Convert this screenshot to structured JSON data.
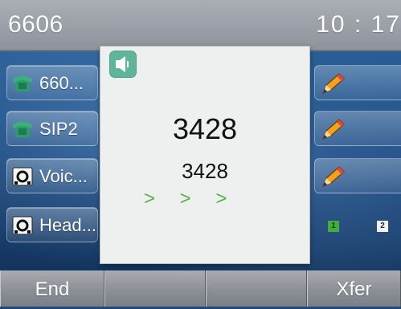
{
  "status_bar": {
    "account": "6606",
    "clock": "10 : 17"
  },
  "line_keys": [
    {
      "label": "660...",
      "icon": "phone-icon"
    },
    {
      "label": "SIP2",
      "icon": "phone-icon"
    },
    {
      "label": "Voic...",
      "icon": "voicemail-icon"
    },
    {
      "label": "Head...",
      "icon": "headset-icon"
    }
  ],
  "right_keys": [
    {
      "icon": "pencil-icon"
    },
    {
      "icon": "pencil-icon"
    },
    {
      "icon": "pencil-icon"
    }
  ],
  "call": {
    "number": "3428",
    "name": "3428",
    "status_icon": "speaker-icon",
    "progress_arrows": "> > >"
  },
  "pages": {
    "page1": "1",
    "page2": "2",
    "active": "1"
  },
  "softkeys": {
    "key1": "End",
    "key2": "",
    "key3": "",
    "key4": "Xfer"
  },
  "colors": {
    "accent_green": "#53b04a",
    "speaker_badge": "#5fb59a",
    "pencil_orange": "#f3a21f"
  }
}
